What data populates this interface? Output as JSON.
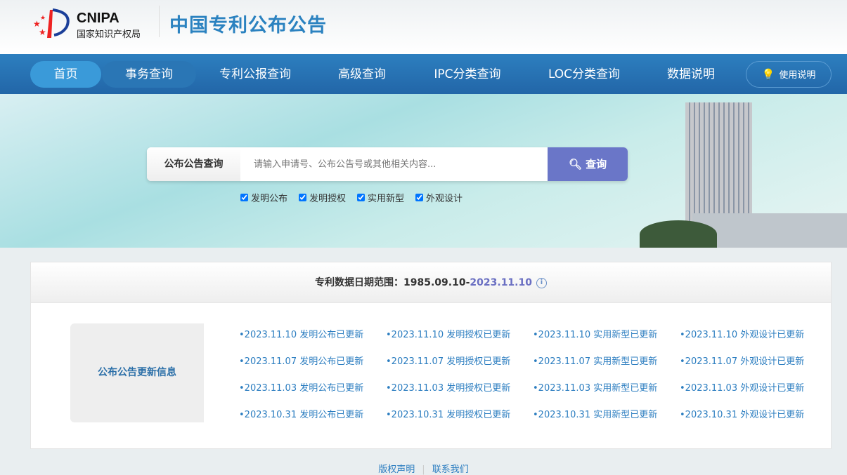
{
  "header": {
    "logo_en": "CNIPA",
    "logo_zh": "国家知识产权局",
    "site_title": "中国专利公布公告"
  },
  "nav": {
    "items": [
      "首页",
      "事务查询",
      "专利公报查询",
      "高级查询",
      "IPC分类查询",
      "LOC分类查询",
      "数据说明"
    ],
    "help": "使用说明"
  },
  "search": {
    "label": "公布公告查询",
    "placeholder": "请输入申请号、公布公告号或其他相关内容...",
    "button": "查询",
    "types": [
      "发明公布",
      "发明授权",
      "实用新型",
      "外观设计"
    ]
  },
  "range": {
    "label": "专利数据日期范围：",
    "start": "1985.09.10-",
    "end": "2023.11.10"
  },
  "updates": {
    "title": "公布公告更新信息",
    "items": [
      "•2023.11.10 发明公布已更新",
      "•2023.11.10 发明授权已更新",
      "•2023.11.10 实用新型已更新",
      "•2023.11.10 外观设计已更新",
      "•2023.11.07 发明公布已更新",
      "•2023.11.07 发明授权已更新",
      "•2023.11.07 实用新型已更新",
      "•2023.11.07 外观设计已更新",
      "•2023.11.03 发明公布已更新",
      "•2023.11.03 发明授权已更新",
      "•2023.11.03 实用新型已更新",
      "•2023.11.03 外观设计已更新",
      "•2023.10.31 发明公布已更新",
      "•2023.10.31 发明授权已更新",
      "•2023.10.31 实用新型已更新",
      "•2023.10.31 外观设计已更新"
    ]
  },
  "footer": {
    "copyright": "版权声明",
    "contact": "联系我们"
  }
}
